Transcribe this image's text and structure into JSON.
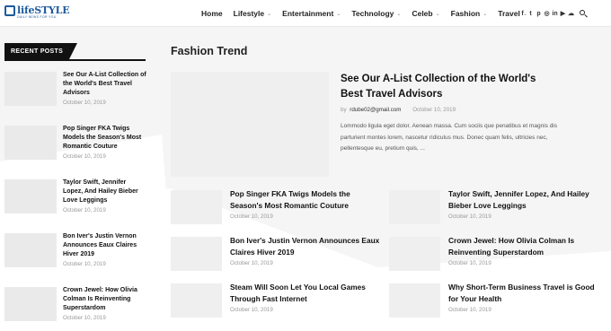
{
  "header": {
    "logo": {
      "name": "lifeSTYLE",
      "tagline": "DAILY NEWS FOR YOU"
    },
    "nav": [
      {
        "label": "Home",
        "has_dropdown": false
      },
      {
        "label": "Lifestyle",
        "has_dropdown": true
      },
      {
        "label": "Entertainment",
        "has_dropdown": true
      },
      {
        "label": "Technology",
        "has_dropdown": true
      },
      {
        "label": "Celeb",
        "has_dropdown": true
      },
      {
        "label": "Fashion",
        "has_dropdown": true
      },
      {
        "label": "Travel",
        "has_dropdown": true
      }
    ],
    "dropdown_glyph": "⌄",
    "social_icons": [
      {
        "name": "facebook-icon",
        "glyph": "f"
      },
      {
        "name": "twitter-icon",
        "glyph": "t"
      },
      {
        "name": "pinterest-icon",
        "glyph": "p"
      },
      {
        "name": "instagram-icon",
        "glyph": "◎"
      },
      {
        "name": "linkedin-icon",
        "glyph": "in"
      },
      {
        "name": "youtube-icon",
        "glyph": "▶"
      },
      {
        "name": "soundcloud-icon",
        "glyph": "☁"
      }
    ]
  },
  "sidebar": {
    "widget_title": "RECENT POSTS",
    "posts": [
      {
        "title": "See Our A-List Collection of the World's Best Travel Advisors",
        "date": "October 10, 2019"
      },
      {
        "title": "Pop Singer FKA Twigs Models the Season's Most Romantic Couture",
        "date": "October 10, 2019"
      },
      {
        "title": "Taylor Swift, Jennifer Lopez, And Hailey Bieber Love Leggings",
        "date": "October 10, 2019"
      },
      {
        "title": "Bon Iver's Justin Vernon Announces Eaux Claires Hiver 2019",
        "date": "October 10, 2019"
      },
      {
        "title": "Crown Jewel: How Olivia Colman Is Reinventing Superstardom",
        "date": "October 10, 2019"
      }
    ]
  },
  "main": {
    "section_title": "Fashion Trend",
    "featured": {
      "title": "See Our A-List Collection of the World's Best Travel Advisors",
      "by": "by",
      "author": "rdube02@gmail.com",
      "date": "October 10, 2019",
      "excerpt": "Lommodo ligula eget dolor. Aenean massa. Cum sociis que penatibus et magnis dis parturient montes lorem, nascetur ridiculus mus. Donec quam felis, ultricies nec, pellentesque eu, pretium quis, ..."
    },
    "grid": [
      {
        "title": "Pop Singer FKA Twigs Models the Season's Most Romantic Couture",
        "date": "October 10, 2019"
      },
      {
        "title": "Taylor Swift, Jennifer Lopez, And Hailey Bieber Love Leggings",
        "date": "October 10, 2019"
      },
      {
        "title": "Bon Iver's Justin Vernon Announces Eaux Claires Hiver 2019",
        "date": "October 10, 2019"
      },
      {
        "title": "Crown Jewel: How Olivia Colman Is Reinventing Superstardom",
        "date": "October 10, 2019"
      },
      {
        "title": "Steam Will Soon Let You Local Games Through Fast Internet",
        "date": "October 10, 2019"
      },
      {
        "title": "Why Short-Term Business Travel is Good for Your Health",
        "date": "October 10, 2019"
      }
    ]
  }
}
